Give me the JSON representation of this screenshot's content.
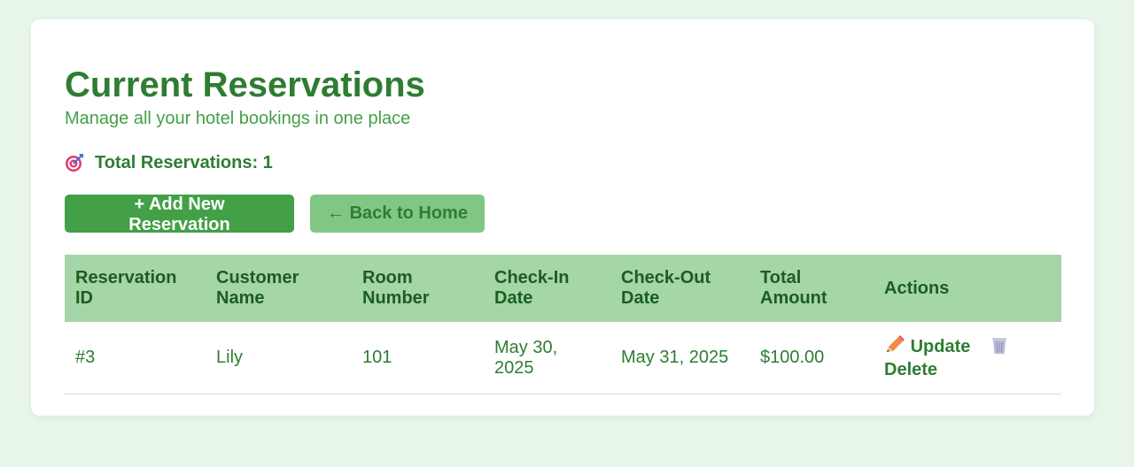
{
  "header": {
    "title": "Current Reservations",
    "subtitle": "Manage all your hotel bookings in one place"
  },
  "summary": {
    "total_label": "Total Reservations: 1"
  },
  "buttons": {
    "add_label": "+ Add New Reservation",
    "back_label": "← Back to Home"
  },
  "table": {
    "columns": [
      "Reservation ID",
      "Customer Name",
      "Room Number",
      "Check-In Date",
      "Check-Out Date",
      "Total Amount",
      "Actions"
    ],
    "rows": [
      {
        "id": "#3",
        "customer": "Lily",
        "room": "101",
        "check_in": "May 30, 2025",
        "check_out": "May 31, 2025",
        "amount": "$100.00",
        "update_label": "Update",
        "delete_label": "Delete"
      }
    ]
  },
  "icons": {
    "summary_icon": "target-icon",
    "update_icon": "pencil-icon",
    "delete_icon": "trash-icon"
  },
  "colors": {
    "page_bg": "#e8f5e9",
    "primary": "#43a047",
    "secondary": "#81c784",
    "header_row": "#a5d6a7",
    "text_dark": "#2e7d32"
  }
}
